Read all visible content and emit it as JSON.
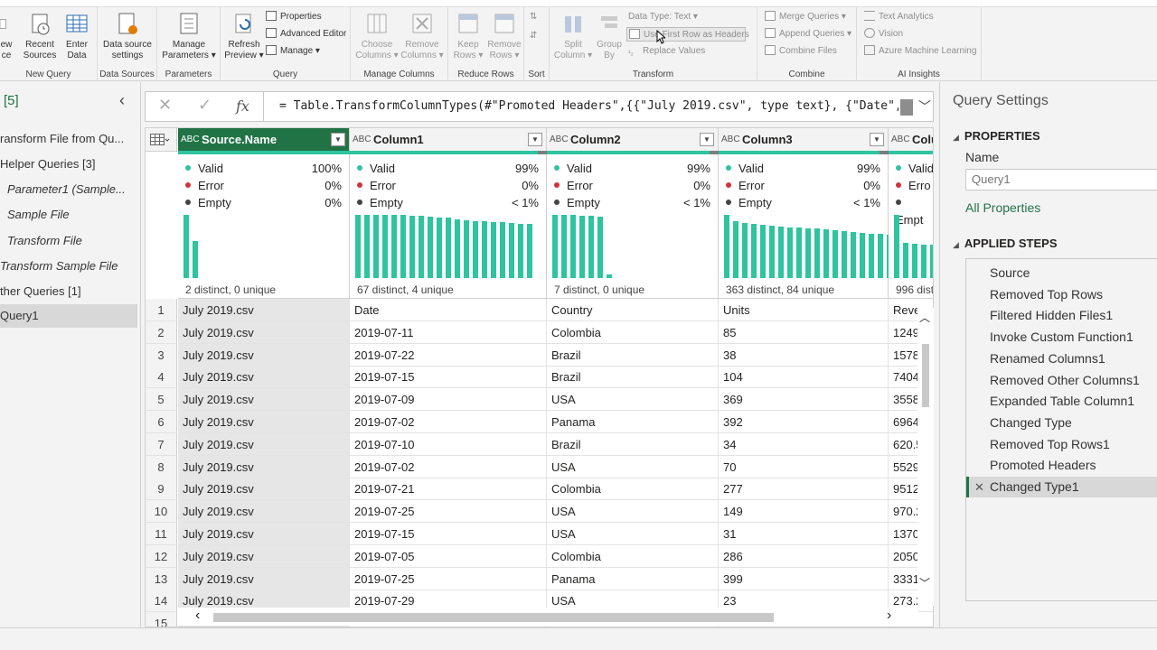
{
  "ribbon": {
    "new_query": {
      "new_source": "New\nSource",
      "new_source_a": "ew",
      "new_source_b": "ce",
      "recent_a": "Recent",
      "recent_b": "Sources",
      "enter_a": "Enter",
      "enter_b": "Data",
      "label": "New Query"
    },
    "data_sources": {
      "btn_a": "Data source",
      "btn_b": "settings",
      "label": "Data Sources"
    },
    "parameters": {
      "btn_a": "Manage",
      "btn_b": "Parameters",
      "label": "Parameters"
    },
    "query": {
      "refresh_a": "Refresh",
      "refresh_b": "Preview",
      "properties": "Properties",
      "advanced_editor": "Advanced Editor",
      "manage": "Manage",
      "label": "Query"
    },
    "manage_columns": {
      "choose_a": "Choose",
      "choose_b": "Columns",
      "remove_a": "Remove",
      "remove_b": "Columns",
      "label": "Manage Columns"
    },
    "reduce_rows": {
      "keep_a": "Keep",
      "keep_b": "Rows",
      "remove_a": "Remove",
      "remove_b": "Rows",
      "label": "Reduce Rows"
    },
    "sort": {
      "label": "Sort"
    },
    "transform": {
      "split_a": "Split",
      "split_b": "Column",
      "group_a": "Group",
      "group_b": "By",
      "data_type": "Data Type: Text",
      "use_first_row": "Use First Row as Headers",
      "replace_values": "Replace Values",
      "label": "Transform"
    },
    "combine": {
      "merge": "Merge Queries",
      "append": "Append Queries",
      "combine_files": "Combine Files",
      "label": "Combine"
    },
    "ai": {
      "text_analytics": "Text Analytics",
      "vision": "Vision",
      "azure_ml": "Azure Machine Learning",
      "label": "AI Insights"
    }
  },
  "queries_pane": {
    "count": "[5]",
    "items": [
      {
        "label": "ransform File from Qu..."
      },
      {
        "label": "Helper Queries [3]"
      },
      {
        "label": "Parameter1 (Sample..."
      },
      {
        "label": "Sample File"
      },
      {
        "label": "Transform File"
      },
      {
        "label": "Transform Sample File"
      },
      {
        "label": "ther Queries [1]"
      },
      {
        "label": "Query1"
      }
    ]
  },
  "formula_bar": {
    "formula": "= Table.TransformColumnTypes(#\"Promoted Headers\",{{\"July 2019.csv\", type text}, {\"Date\","
  },
  "grid": {
    "columns": [
      {
        "name": "Source.Name",
        "type_icon": "ABC",
        "valid": "Valid",
        "valid_pct": "100%",
        "error": "Error",
        "error_pct": "0%",
        "empty": "Empty",
        "empty_pct": "0%",
        "distinct": "2 distinct, 0 unique"
      },
      {
        "name": "Column1",
        "type_icon": "ABC",
        "valid": "Valid",
        "valid_pct": "99%",
        "error": "Error",
        "error_pct": "0%",
        "empty": "Empty",
        "empty_pct": "< 1%",
        "distinct": "67 distinct, 4 unique"
      },
      {
        "name": "Column2",
        "type_icon": "ABC",
        "valid": "Valid",
        "valid_pct": "99%",
        "error": "Error",
        "error_pct": "0%",
        "empty": "Empty",
        "empty_pct": "< 1%",
        "distinct": "7 distinct, 0 unique"
      },
      {
        "name": "Column3",
        "type_icon": "ABC",
        "valid": "Valid",
        "valid_pct": "99%",
        "error": "Error",
        "error_pct": "0%",
        "empty": "Empty",
        "empty_pct": "< 1%",
        "distinct": "363 distinct, 84 unique"
      },
      {
        "name": "Colu",
        "type_icon": "ABC",
        "valid": "Valid",
        "valid_pct": "",
        "error": "Erro",
        "error_pct": "",
        "empty": "Empt",
        "empty_pct": "",
        "distinct": "996 dist"
      }
    ],
    "rows": [
      {
        "n": "1",
        "c": [
          "July 2019.csv",
          "Date",
          "Country",
          "Units",
          "Reve"
        ]
      },
      {
        "n": "2",
        "c": [
          "July 2019.csv",
          "2019-07-11",
          "Colombia",
          "85",
          "1249"
        ]
      },
      {
        "n": "3",
        "c": [
          "July 2019.csv",
          "2019-07-22",
          "Brazil",
          "38",
          "1578"
        ]
      },
      {
        "n": "4",
        "c": [
          "July 2019.csv",
          "2019-07-15",
          "Brazil",
          "104",
          "7404"
        ]
      },
      {
        "n": "5",
        "c": [
          "July 2019.csv",
          "2019-07-09",
          "USA",
          "369",
          "3558"
        ]
      },
      {
        "n": "6",
        "c": [
          "July 2019.csv",
          "2019-07-02",
          "Panama",
          "392",
          "6964"
        ]
      },
      {
        "n": "7",
        "c": [
          "July 2019.csv",
          "2019-07-10",
          "Brazil",
          "34",
          "620.5"
        ]
      },
      {
        "n": "8",
        "c": [
          "July 2019.csv",
          "2019-07-02",
          "USA",
          "70",
          "5529"
        ]
      },
      {
        "n": "9",
        "c": [
          "July 2019.csv",
          "2019-07-21",
          "Colombia",
          "277",
          "9512"
        ]
      },
      {
        "n": "10",
        "c": [
          "July 2019.csv",
          "2019-07-25",
          "USA",
          "149",
          "970.2"
        ]
      },
      {
        "n": "11",
        "c": [
          "July 2019.csv",
          "2019-07-15",
          "USA",
          "31",
          "1370"
        ]
      },
      {
        "n": "12",
        "c": [
          "July 2019.csv",
          "2019-07-05",
          "Colombia",
          "286",
          "2050"
        ]
      },
      {
        "n": "13",
        "c": [
          "July 2019.csv",
          "2019-07-25",
          "Panama",
          "399",
          "3331"
        ]
      },
      {
        "n": "14",
        "c": [
          "July 2019.csv",
          "2019-07-29",
          "USA",
          "23",
          "273.2"
        ]
      },
      {
        "n": "15",
        "c": [
          "",
          "",
          "",
          "",
          ""
        ]
      }
    ],
    "distribution": [
      [
        1.0,
        0.58
      ],
      [
        1.0,
        1.0,
        1.0,
        1.0,
        1.0,
        1.0,
        0.99,
        0.98,
        0.97,
        0.96,
        0.95,
        0.93,
        0.92,
        0.9,
        0.9,
        0.89,
        0.88,
        0.87,
        0.86,
        0.85
      ],
      [
        1.0,
        1.0,
        1.0,
        0.99,
        0.98,
        0.97,
        0.05
      ],
      [
        1.0,
        0.9,
        0.87,
        0.85,
        0.84,
        0.83,
        0.82,
        0.8,
        0.8,
        0.79,
        0.78,
        0.77,
        0.75,
        0.74,
        0.73,
        0.72,
        0.7,
        0.7,
        0.69,
        0.68
      ],
      [
        1.0,
        0.55,
        0.54,
        0.53,
        0.53,
        0.52
      ]
    ]
  },
  "query_settings": {
    "title": "Query Settings",
    "properties": "PROPERTIES",
    "name_label": "Name",
    "name_value": "Query1",
    "all_properties": "All Properties",
    "applied_steps": "APPLIED STEPS",
    "steps": [
      {
        "label": "Source"
      },
      {
        "label": "Removed Top Rows"
      },
      {
        "label": "Filtered Hidden Files1"
      },
      {
        "label": "Invoke Custom Function1"
      },
      {
        "label": "Renamed Columns1"
      },
      {
        "label": "Removed Other Columns1"
      },
      {
        "label": "Expanded Table Column1"
      },
      {
        "label": "Changed Type"
      },
      {
        "label": "Removed Top Rows1"
      },
      {
        "label": "Promoted Headers"
      },
      {
        "label": "Changed Type1"
      }
    ]
  },
  "colors": {
    "accent": "#217346",
    "quality_bar": "#2ec4a0",
    "valid_dot": "#2ec4a0",
    "error_dot": "#d13438",
    "empty_dot": "#444444"
  }
}
